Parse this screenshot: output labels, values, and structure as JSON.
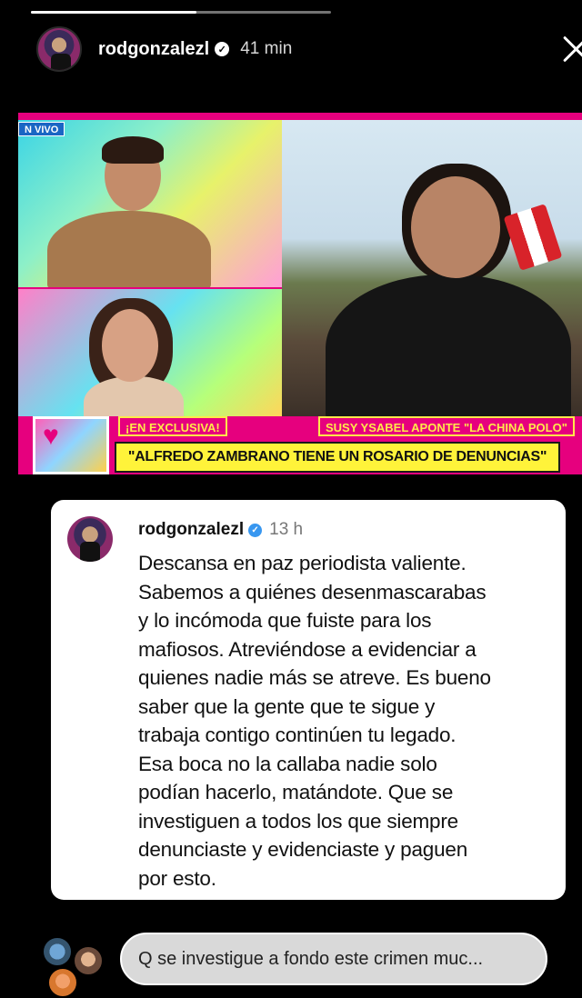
{
  "story": {
    "progress": 0.55,
    "username": "rodgonzalezl",
    "time": "41 min",
    "close_icon": "close-icon"
  },
  "tv": {
    "live_label": "N VIVO",
    "tag_left": "¡EN EXCLUSIVA!",
    "tag_right": "SUSY YSABEL APONTE \"LA CHINA POLO\"",
    "headline": "\"ALFREDO ZAMBRANO TIENE UN ROSARIO DE DENUNCIAS\"",
    "accent": "#e6007e",
    "headline_bg": "#fff33a"
  },
  "post": {
    "username": "rodgonzalezl",
    "time": "13 h",
    "text": "Descansa en paz periodista valiente.\nSabemos a quiénes desenmascarabas\ny lo incómoda que fuiste para los\nmafiosos. Atreviéndose a evidenciar a\nquienes nadie más se atreve. Es bueno\nsaber que la gente que te sigue y\ntrabaja contigo continúen tu legado.\nEsa boca no la callaba nadie solo\npodían hacerlo, matándote. Que se\ninvestiguen a todos los que siempre\ndenunciaste y evidenciaste y paguen\npor esto."
  },
  "reply": {
    "text": "Q se investigue a fondo este crimen muc..."
  }
}
